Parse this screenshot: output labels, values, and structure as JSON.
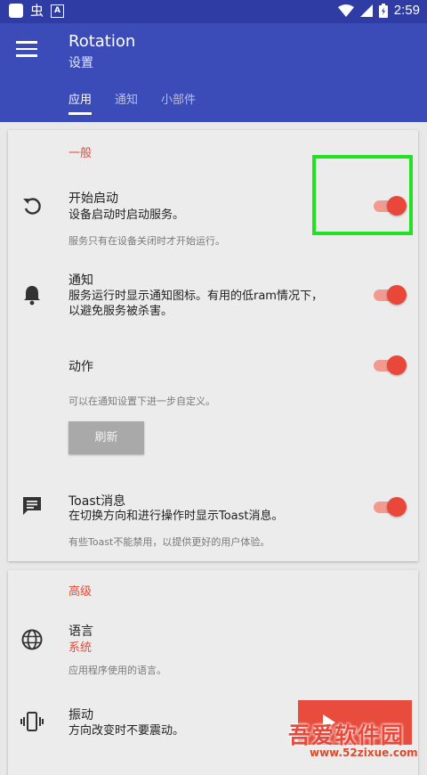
{
  "status_bar": {
    "time": "2:59",
    "app_glyph": "虫",
    "a_badge": "A"
  },
  "header": {
    "title": "Rotation",
    "subtitle": "设置"
  },
  "tabs": [
    {
      "label": "应用",
      "active": true
    },
    {
      "label": "通知",
      "active": false
    },
    {
      "label": "小部件",
      "active": false
    }
  ],
  "general": {
    "section_title": "一般",
    "start_on_boot": {
      "title": "开始启动",
      "desc": "设备启动时启动服务。",
      "hint": "服务只有在设备关闭时才开始运行。",
      "enabled": true,
      "icon": "restore-icon"
    },
    "notification": {
      "title": "通知",
      "desc_line1": "服务运行时显示通知图标。有用的低ram情况下，",
      "desc_line2": "以避免服务被杀害。",
      "enabled": true,
      "icon": "bell-icon"
    },
    "actions": {
      "title": "动作",
      "hint": "可以在通知设置下进一步自定义。",
      "refresh_label": "刷新",
      "enabled": true
    },
    "toast": {
      "title": "Toast消息",
      "desc": "在切换方向和进行操作时显示Toast消息。",
      "hint": "有些Toast不能禁用，以提供更好的用户体验。",
      "enabled": true,
      "icon": "message-icon"
    }
  },
  "advanced": {
    "section_title": "高级",
    "language": {
      "title": "语言",
      "value": "系统",
      "hint": "应用程序使用的语言。",
      "icon": "globe-icon"
    },
    "vibration": {
      "title": "振动",
      "desc": "方向改变时不要震动。",
      "icon": "vibration-icon"
    }
  },
  "watermark": {
    "text": "吾爱软件园",
    "url": "www.52zixue.com"
  },
  "colors": {
    "primary": "#3b4cb8",
    "status_bar": "#2f3ca3",
    "accent": "#e8473a",
    "highlight": "#22e022"
  }
}
